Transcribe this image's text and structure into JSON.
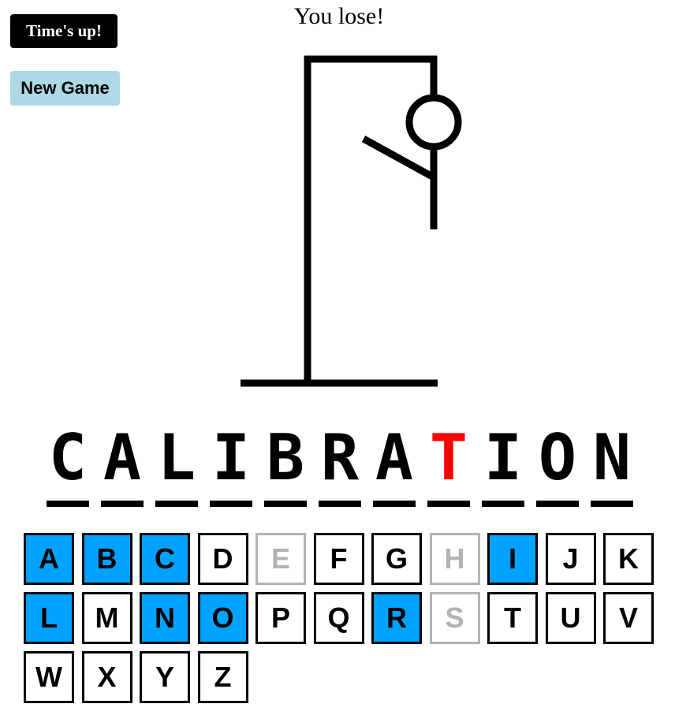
{
  "status": "You lose!",
  "timer_label": "Time's up!",
  "new_game_label": "New Game",
  "colors": {
    "correct_key": "#00a2ff",
    "wrong_key": "#b3b3b3",
    "missed_letter": "#ff0000",
    "new_game": "#add8e6"
  },
  "word": {
    "letters": [
      {
        "char": "C",
        "missed": false
      },
      {
        "char": "A",
        "missed": false
      },
      {
        "char": "L",
        "missed": false
      },
      {
        "char": "I",
        "missed": false
      },
      {
        "char": "B",
        "missed": false
      },
      {
        "char": "R",
        "missed": false
      },
      {
        "char": "A",
        "missed": false
      },
      {
        "char": "T",
        "missed": true
      },
      {
        "char": "I",
        "missed": false
      },
      {
        "char": "O",
        "missed": false
      },
      {
        "char": "N",
        "missed": false
      }
    ]
  },
  "keyboard": {
    "keys": [
      {
        "letter": "A",
        "state": "correct"
      },
      {
        "letter": "B",
        "state": "correct"
      },
      {
        "letter": "C",
        "state": "correct"
      },
      {
        "letter": "D",
        "state": "unused"
      },
      {
        "letter": "E",
        "state": "wrong"
      },
      {
        "letter": "F",
        "state": "unused"
      },
      {
        "letter": "G",
        "state": "unused"
      },
      {
        "letter": "H",
        "state": "wrong"
      },
      {
        "letter": "I",
        "state": "correct"
      },
      {
        "letter": "J",
        "state": "unused"
      },
      {
        "letter": "K",
        "state": "unused"
      },
      {
        "letter": "L",
        "state": "correct"
      },
      {
        "letter": "M",
        "state": "unused"
      },
      {
        "letter": "N",
        "state": "correct"
      },
      {
        "letter": "O",
        "state": "correct"
      },
      {
        "letter": "P",
        "state": "unused"
      },
      {
        "letter": "Q",
        "state": "unused"
      },
      {
        "letter": "R",
        "state": "correct"
      },
      {
        "letter": "S",
        "state": "wrong"
      },
      {
        "letter": "T",
        "state": "unused"
      },
      {
        "letter": "U",
        "state": "unused"
      },
      {
        "letter": "V",
        "state": "unused"
      },
      {
        "letter": "W",
        "state": "unused"
      },
      {
        "letter": "X",
        "state": "unused"
      },
      {
        "letter": "Y",
        "state": "unused"
      },
      {
        "letter": "Z",
        "state": "unused"
      }
    ]
  }
}
